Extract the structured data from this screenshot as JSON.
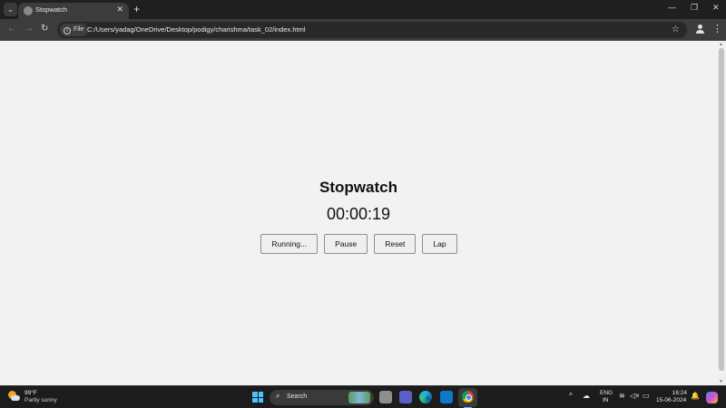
{
  "browser": {
    "tab_title": "Stopwatch",
    "tab_close": "✕",
    "new_tab": "+",
    "menu_btn": "⌄",
    "site_chip": "File",
    "url": "C:/Users/yadag/OneDrive/Desktop/podigy/charishma/task_02/index.html",
    "nav": {
      "back": "←",
      "forward": "→",
      "reload": "↻"
    },
    "star": "☆",
    "menu": "⋮",
    "window": {
      "minimize": "—",
      "maximize": "❐",
      "close": "✕"
    }
  },
  "app": {
    "title": "Stopwatch",
    "time": "00:00:19",
    "buttons": {
      "start": "Running...",
      "pause": "Pause",
      "reset": "Reset",
      "lap": "Lap"
    }
  },
  "taskbar": {
    "weather_temp": "99°F",
    "weather_desc": "Partly sunny",
    "search_label": "Search",
    "search_icon": "⌕",
    "lang_line1": "ENG",
    "lang_line2": "IN",
    "time": "16:24",
    "date": "15-06-2024",
    "tray_chevron": "^",
    "tray_wifi": "≋",
    "tray_volume": "◁×",
    "tray_battery": "▭",
    "tray_bell": "🔔"
  }
}
